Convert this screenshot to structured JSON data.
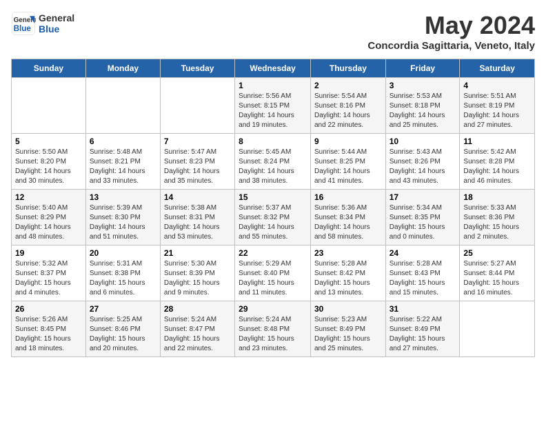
{
  "header": {
    "logo_line1": "General",
    "logo_line2": "Blue",
    "month_title": "May 2024",
    "subtitle": "Concordia Sagittaria, Veneto, Italy"
  },
  "weekdays": [
    "Sunday",
    "Monday",
    "Tuesday",
    "Wednesday",
    "Thursday",
    "Friday",
    "Saturday"
  ],
  "weeks": [
    [
      {
        "day": "",
        "sunrise": "",
        "sunset": "",
        "daylight": ""
      },
      {
        "day": "",
        "sunrise": "",
        "sunset": "",
        "daylight": ""
      },
      {
        "day": "",
        "sunrise": "",
        "sunset": "",
        "daylight": ""
      },
      {
        "day": "1",
        "sunrise": "Sunrise: 5:56 AM",
        "sunset": "Sunset: 8:15 PM",
        "daylight": "Daylight: 14 hours and 19 minutes."
      },
      {
        "day": "2",
        "sunrise": "Sunrise: 5:54 AM",
        "sunset": "Sunset: 8:16 PM",
        "daylight": "Daylight: 14 hours and 22 minutes."
      },
      {
        "day": "3",
        "sunrise": "Sunrise: 5:53 AM",
        "sunset": "Sunset: 8:18 PM",
        "daylight": "Daylight: 14 hours and 25 minutes."
      },
      {
        "day": "4",
        "sunrise": "Sunrise: 5:51 AM",
        "sunset": "Sunset: 8:19 PM",
        "daylight": "Daylight: 14 hours and 27 minutes."
      }
    ],
    [
      {
        "day": "5",
        "sunrise": "Sunrise: 5:50 AM",
        "sunset": "Sunset: 8:20 PM",
        "daylight": "Daylight: 14 hours and 30 minutes."
      },
      {
        "day": "6",
        "sunrise": "Sunrise: 5:48 AM",
        "sunset": "Sunset: 8:21 PM",
        "daylight": "Daylight: 14 hours and 33 minutes."
      },
      {
        "day": "7",
        "sunrise": "Sunrise: 5:47 AM",
        "sunset": "Sunset: 8:23 PM",
        "daylight": "Daylight: 14 hours and 35 minutes."
      },
      {
        "day": "8",
        "sunrise": "Sunrise: 5:45 AM",
        "sunset": "Sunset: 8:24 PM",
        "daylight": "Daylight: 14 hours and 38 minutes."
      },
      {
        "day": "9",
        "sunrise": "Sunrise: 5:44 AM",
        "sunset": "Sunset: 8:25 PM",
        "daylight": "Daylight: 14 hours and 41 minutes."
      },
      {
        "day": "10",
        "sunrise": "Sunrise: 5:43 AM",
        "sunset": "Sunset: 8:26 PM",
        "daylight": "Daylight: 14 hours and 43 minutes."
      },
      {
        "day": "11",
        "sunrise": "Sunrise: 5:42 AM",
        "sunset": "Sunset: 8:28 PM",
        "daylight": "Daylight: 14 hours and 46 minutes."
      }
    ],
    [
      {
        "day": "12",
        "sunrise": "Sunrise: 5:40 AM",
        "sunset": "Sunset: 8:29 PM",
        "daylight": "Daylight: 14 hours and 48 minutes."
      },
      {
        "day": "13",
        "sunrise": "Sunrise: 5:39 AM",
        "sunset": "Sunset: 8:30 PM",
        "daylight": "Daylight: 14 hours and 51 minutes."
      },
      {
        "day": "14",
        "sunrise": "Sunrise: 5:38 AM",
        "sunset": "Sunset: 8:31 PM",
        "daylight": "Daylight: 14 hours and 53 minutes."
      },
      {
        "day": "15",
        "sunrise": "Sunrise: 5:37 AM",
        "sunset": "Sunset: 8:32 PM",
        "daylight": "Daylight: 14 hours and 55 minutes."
      },
      {
        "day": "16",
        "sunrise": "Sunrise: 5:36 AM",
        "sunset": "Sunset: 8:34 PM",
        "daylight": "Daylight: 14 hours and 58 minutes."
      },
      {
        "day": "17",
        "sunrise": "Sunrise: 5:34 AM",
        "sunset": "Sunset: 8:35 PM",
        "daylight": "Daylight: 15 hours and 0 minutes."
      },
      {
        "day": "18",
        "sunrise": "Sunrise: 5:33 AM",
        "sunset": "Sunset: 8:36 PM",
        "daylight": "Daylight: 15 hours and 2 minutes."
      }
    ],
    [
      {
        "day": "19",
        "sunrise": "Sunrise: 5:32 AM",
        "sunset": "Sunset: 8:37 PM",
        "daylight": "Daylight: 15 hours and 4 minutes."
      },
      {
        "day": "20",
        "sunrise": "Sunrise: 5:31 AM",
        "sunset": "Sunset: 8:38 PM",
        "daylight": "Daylight: 15 hours and 6 minutes."
      },
      {
        "day": "21",
        "sunrise": "Sunrise: 5:30 AM",
        "sunset": "Sunset: 8:39 PM",
        "daylight": "Daylight: 15 hours and 9 minutes."
      },
      {
        "day": "22",
        "sunrise": "Sunrise: 5:29 AM",
        "sunset": "Sunset: 8:40 PM",
        "daylight": "Daylight: 15 hours and 11 minutes."
      },
      {
        "day": "23",
        "sunrise": "Sunrise: 5:28 AM",
        "sunset": "Sunset: 8:42 PM",
        "daylight": "Daylight: 15 hours and 13 minutes."
      },
      {
        "day": "24",
        "sunrise": "Sunrise: 5:28 AM",
        "sunset": "Sunset: 8:43 PM",
        "daylight": "Daylight: 15 hours and 15 minutes."
      },
      {
        "day": "25",
        "sunrise": "Sunrise: 5:27 AM",
        "sunset": "Sunset: 8:44 PM",
        "daylight": "Daylight: 15 hours and 16 minutes."
      }
    ],
    [
      {
        "day": "26",
        "sunrise": "Sunrise: 5:26 AM",
        "sunset": "Sunset: 8:45 PM",
        "daylight": "Daylight: 15 hours and 18 minutes."
      },
      {
        "day": "27",
        "sunrise": "Sunrise: 5:25 AM",
        "sunset": "Sunset: 8:46 PM",
        "daylight": "Daylight: 15 hours and 20 minutes."
      },
      {
        "day": "28",
        "sunrise": "Sunrise: 5:24 AM",
        "sunset": "Sunset: 8:47 PM",
        "daylight": "Daylight: 15 hours and 22 minutes."
      },
      {
        "day": "29",
        "sunrise": "Sunrise: 5:24 AM",
        "sunset": "Sunset: 8:48 PM",
        "daylight": "Daylight: 15 hours and 23 minutes."
      },
      {
        "day": "30",
        "sunrise": "Sunrise: 5:23 AM",
        "sunset": "Sunset: 8:49 PM",
        "daylight": "Daylight: 15 hours and 25 minutes."
      },
      {
        "day": "31",
        "sunrise": "Sunrise: 5:22 AM",
        "sunset": "Sunset: 8:49 PM",
        "daylight": "Daylight: 15 hours and 27 minutes."
      },
      {
        "day": "",
        "sunrise": "",
        "sunset": "",
        "daylight": ""
      }
    ]
  ]
}
